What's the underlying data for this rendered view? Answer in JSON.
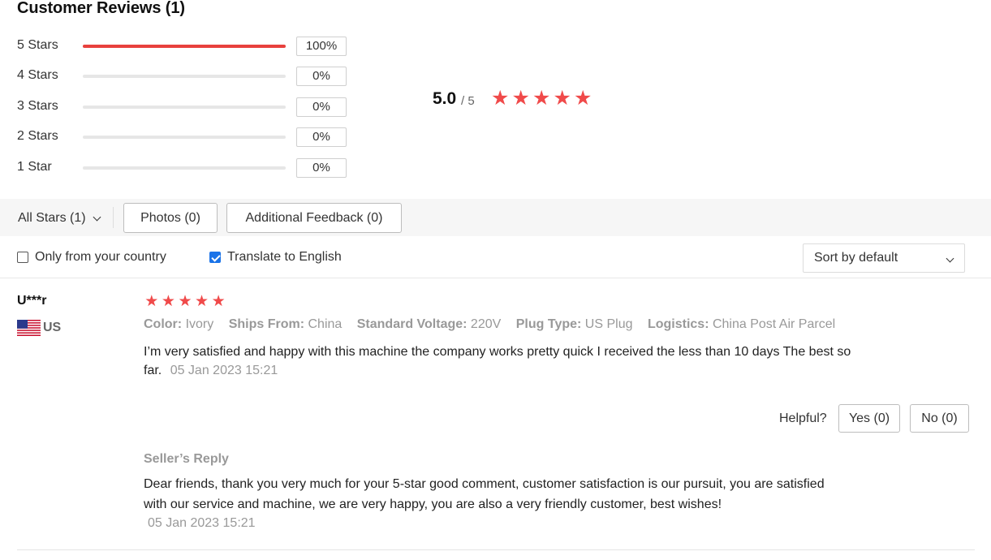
{
  "header": {
    "title": "Customer Reviews (1)"
  },
  "distribution": [
    {
      "label": "5 Stars",
      "percent": "100%",
      "fill": 1.0
    },
    {
      "label": "4 Stars",
      "percent": "0%",
      "fill": 0
    },
    {
      "label": "3 Stars",
      "percent": "0%",
      "fill": 0
    },
    {
      "label": "2 Stars",
      "percent": "0%",
      "fill": 0
    },
    {
      "label": "1 Star",
      "percent": "0%",
      "fill": 0
    }
  ],
  "summary": {
    "average": "5.0",
    "max": "/ 5",
    "stars": 5,
    "star_color": "#f04a4a"
  },
  "filters": {
    "all_stars": "All Stars (1)",
    "photos": "Photos (0)",
    "additional": "Additional Feedback (0)"
  },
  "options": {
    "only_country": {
      "label": "Only from your country",
      "checked": false
    },
    "translate": {
      "label": "Translate to English",
      "checked": true
    },
    "sort": "Sort by default"
  },
  "review": {
    "reviewer": "U***r",
    "country": "US",
    "stars": 5,
    "attributes": [
      {
        "key": "Color:",
        "value": "Ivory"
      },
      {
        "key": "Ships From:",
        "value": "China"
      },
      {
        "key": "Standard Voltage:",
        "value": "220V"
      },
      {
        "key": "Plug Type:",
        "value": "US Plug"
      },
      {
        "key": "Logistics:",
        "value": "China Post Air Parcel"
      }
    ],
    "text": "I’m very satisfied and happy with this machine the company works pretty quick I received the less than 10 days The best so far.",
    "date": "05 Jan 2023 15:21",
    "helpful_label": "Helpful?",
    "yes": "Yes (0)",
    "no": "No (0)",
    "seller_reply_title": "Seller’s Reply",
    "seller_reply_text": "Dear friends, thank you very much for your 5-star good comment, customer satisfaction is our pursuit, you are satisfied with our service and machine, we are very happy, you are also a very friendly customer, best wishes!",
    "seller_reply_date": "05 Jan 2023 15:21"
  }
}
